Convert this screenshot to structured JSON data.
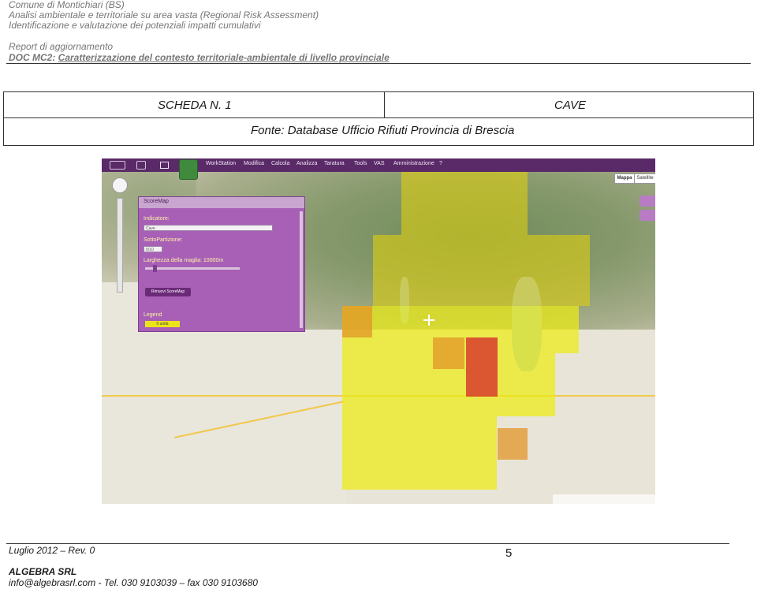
{
  "header": {
    "line1": "Comune di Montichiari (BS)",
    "line2": "Analisi ambientale e territoriale su area vasta (Regional Risk Assessment)",
    "line3": "Identificazione e valutazione dei potenziali impatti cumulativi",
    "line4": "Report di aggiornamento",
    "line5_prefix": "DOC MC2: ",
    "line5_title": "Caratterizzazione del contesto territoriale-ambientale di livello provinciale"
  },
  "scheda": {
    "number_label": "SCHEDA N. 1",
    "topic": "CAVE",
    "source": "Fonte: Database Ufficio Rifiuti Provincia di Brescia"
  },
  "map": {
    "toolbar_items": [
      "WorkStation",
      "Modifica",
      "Calcola",
      "Analizza",
      "Taratura",
      "Tools",
      "VAS",
      "Amministrazione",
      "?"
    ],
    "map_type_buttons": [
      "Mappa",
      "Satellite"
    ],
    "panel": {
      "title": "ScoreMap",
      "indicator_label": "Indicatore:",
      "indicator_value": "Cave",
      "subpartition_label": "SottoPartizione:",
      "subpartition_value": "0/10",
      "mesh_label": "Larghezza della maglia: 10000m",
      "remove_button": "Rimuovi ScoreMap",
      "legend_label": "Legend",
      "legend_item": "0 unità"
    },
    "colors": {
      "toolbar": "#5a2a68",
      "panel": "#a860b6",
      "score_low": "#ebeb14",
      "score_mid": "#e19628",
      "score_high": "#d21e28"
    }
  },
  "footer": {
    "date": "Luglio 2012 – Rev. 0",
    "page": "5",
    "company": "ALGEBRA SRL",
    "contact": "info@algebrasrl.com - Tel. 030 9103039 – fax 030 9103680"
  }
}
